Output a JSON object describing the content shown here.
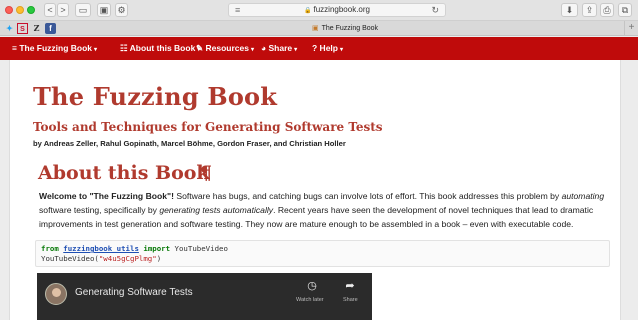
{
  "browser": {
    "url": "fuzzingbook.org",
    "tab_title": "The Fuzzing Book",
    "favorites": [
      "S",
      "Z",
      "f"
    ],
    "nav_back": "<",
    "nav_forward": ">",
    "reload_icon": "↻"
  },
  "nav": {
    "items": [
      {
        "label": "≡ The Fuzzing Book",
        "caret": "▾"
      },
      {
        "label": "☷ About this Book",
        "caret": "▾"
      },
      {
        "label": "✎ Resources",
        "caret": "▾"
      },
      {
        "label": "◕ Share",
        "caret": "▾"
      },
      {
        "label": "? Help",
        "caret": "▾"
      }
    ]
  },
  "book": {
    "title": "The Fuzzing Book",
    "subtitle": "Tools and Techniques for Generating Software Tests",
    "authors": "by Andreas Zeller, Rahul Gopinath, Marcel Böhme, Gordon Fraser, and Christian Holler"
  },
  "section": {
    "title": "About this Book",
    "pilcrow": "¶"
  },
  "intro": {
    "lead": "Welcome to \"The Fuzzing Book\"!",
    "t1": " Software has bugs, and catching bugs can involve lots of effort. This book addresses this problem by ",
    "e1": "automating",
    "t2": " software testing, specifically by ",
    "e2": "generating tests automatically",
    "t3": ". Recent years have seen the development of novel techniques that lead to dramatic improvements in test generation and software testing. They now are mature enough to be assembled in a book – even with executable code."
  },
  "code": {
    "from": "from",
    "module": "fuzzingbook_utils",
    "import": "import",
    "name": " YouTubeVideo",
    "call": "YouTubeVideo(",
    "arg": "\"w4u5gCgPlmg\"",
    "close": ")"
  },
  "video": {
    "title": "Generating Software Tests",
    "watch_later": "Watch later",
    "share": "Share"
  }
}
